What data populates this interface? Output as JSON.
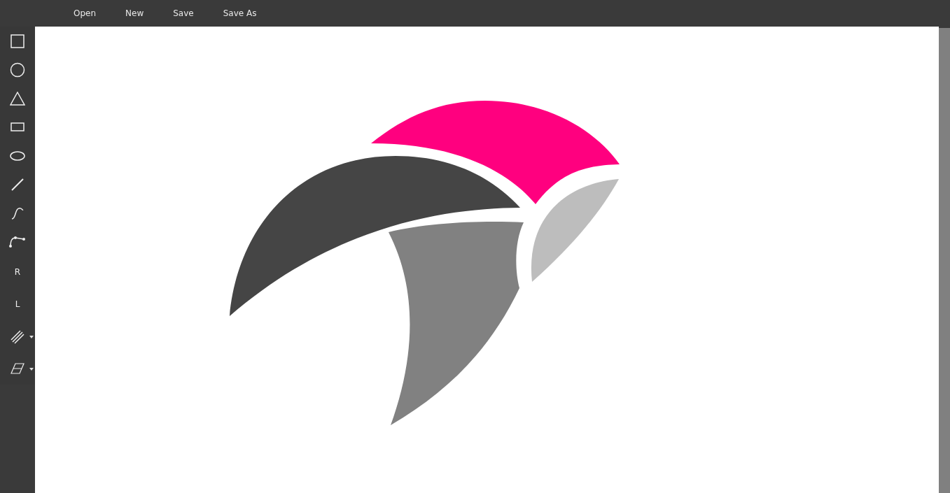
{
  "menu": [
    {
      "label": "Open"
    },
    {
      "label": "New"
    },
    {
      "label": "Save"
    },
    {
      "label": "Save As"
    }
  ],
  "tools": [
    {
      "kind": "square",
      "has_menu": false
    },
    {
      "kind": "circle",
      "has_menu": false
    },
    {
      "kind": "triangle",
      "has_menu": false
    },
    {
      "kind": "rectangle",
      "has_menu": false
    },
    {
      "kind": "ellipse",
      "has_menu": false
    },
    {
      "kind": "line",
      "has_menu": false
    },
    {
      "kind": "curve",
      "has_menu": false
    },
    {
      "kind": "bezier",
      "has_menu": false
    },
    {
      "kind": "letter",
      "label": "R",
      "has_menu": false
    },
    {
      "kind": "letter",
      "label": "L",
      "has_menu": false
    },
    {
      "kind": "hatch",
      "has_menu": true
    },
    {
      "kind": "eraser",
      "has_menu": true
    }
  ]
}
